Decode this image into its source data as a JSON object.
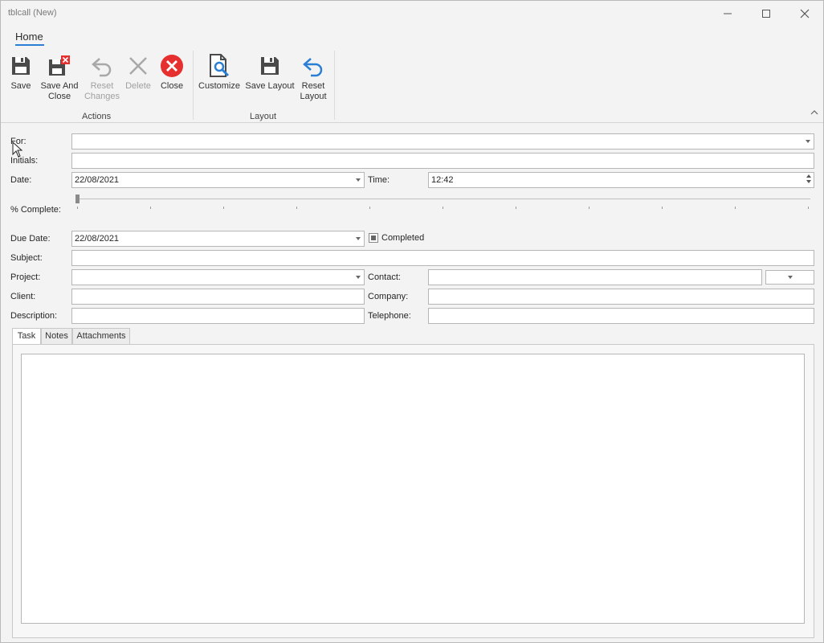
{
  "window": {
    "title": "tblcall (New)",
    "controls": [
      "minimize",
      "maximize",
      "close"
    ]
  },
  "ribbon": {
    "tab": "Home",
    "groups": [
      {
        "label": "Actions",
        "buttons": [
          {
            "label": "Save",
            "icon": "save-icon",
            "enabled": true
          },
          {
            "label": "Save And\nClose",
            "icon": "save-close-icon",
            "enabled": true
          },
          {
            "label": "Reset\nChanges",
            "icon": "undo-icon",
            "enabled": false
          },
          {
            "label": "Delete",
            "icon": "delete-x-icon",
            "enabled": false
          },
          {
            "label": "Close",
            "icon": "close-circle-icon",
            "enabled": true
          }
        ]
      },
      {
        "label": "Layout",
        "buttons": [
          {
            "label": "Customize",
            "icon": "customize-icon",
            "enabled": true
          },
          {
            "label": "Save Layout",
            "icon": "save-icon",
            "enabled": true
          },
          {
            "label": "Reset\nLayout",
            "icon": "undo-blue-icon",
            "enabled": true
          }
        ]
      }
    ]
  },
  "form": {
    "for_label": "For:",
    "for_value": "",
    "initials_label": "Initials:",
    "initials_value": "",
    "date_label": "Date:",
    "date_value": "22/08/2021",
    "time_label": "Time:",
    "time_value": "12:42",
    "complete_label": "% Complete:",
    "complete_value": 0,
    "due_label": "Due Date:",
    "due_value": "22/08/2021",
    "completed_label": "Completed",
    "completed_state": "indeterminate",
    "subject_label": "Subject:",
    "subject_value": "",
    "project_label": "Project:",
    "project_value": "",
    "contact_label": "Contact:",
    "contact_value": "",
    "client_label": "Client:",
    "client_value": "",
    "company_label": "Company:",
    "company_value": "",
    "description_label": "Description:",
    "description_value": "",
    "telephone_label": "Telephone:",
    "telephone_value": ""
  },
  "tabs": [
    "Task",
    "Notes",
    "Attachments"
  ],
  "active_tab": "Task",
  "colors": {
    "accent": "#2a7fd4",
    "close_red": "#e5302f",
    "window_bg": "#f3f3f3"
  }
}
